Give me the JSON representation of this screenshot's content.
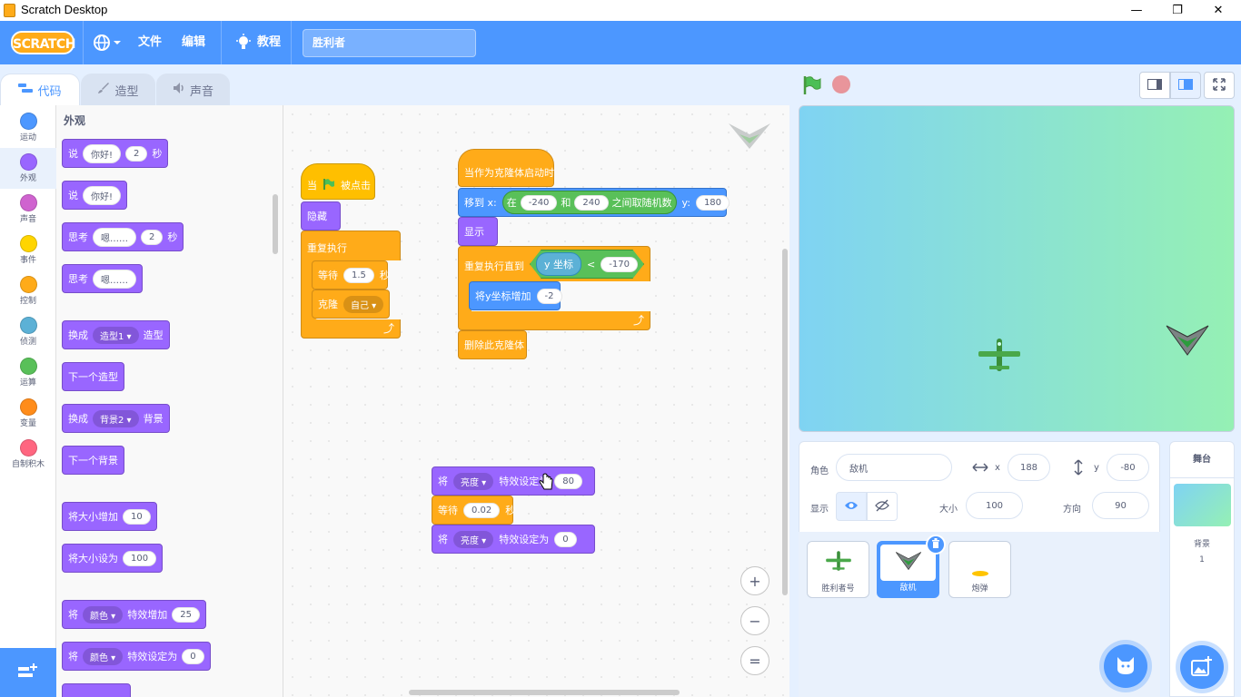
{
  "window": {
    "title": "Scratch Desktop",
    "minimize": "—",
    "restore": "❐",
    "close": "✕"
  },
  "menu": {
    "logo": "SCRATCH",
    "file": "文件",
    "edit": "编辑",
    "tutorials": "教程",
    "project_name": "胜利者"
  },
  "tabs": {
    "code": "代码",
    "costumes": "造型",
    "sounds": "声音"
  },
  "categories": [
    {
      "label": "运动",
      "color": "#4c97ff"
    },
    {
      "label": "外观",
      "color": "#9966ff"
    },
    {
      "label": "声音",
      "color": "#cf63cf"
    },
    {
      "label": "事件",
      "color": "#ffd500"
    },
    {
      "label": "控制",
      "color": "#ffab19"
    },
    {
      "label": "侦测",
      "color": "#5cb1d6"
    },
    {
      "label": "运算",
      "color": "#59c059"
    },
    {
      "label": "变量",
      "color": "#ff8c1a"
    },
    {
      "label": "自制积木",
      "color": "#ff6680"
    }
  ],
  "palette": {
    "title": "外观",
    "say_secs": {
      "a": "说",
      "msg": "你好!",
      "secs": "2",
      "b": "秒"
    },
    "say": {
      "a": "说",
      "msg": "你好!"
    },
    "think_secs": {
      "a": "思考",
      "msg": "嗯……",
      "secs": "2",
      "b": "秒"
    },
    "think": {
      "a": "思考",
      "msg": "嗯……"
    },
    "switch_costume": {
      "a": "换成",
      "dd": "造型1",
      "b": "造型"
    },
    "next_costume": "下一个造型",
    "switch_backdrop": {
      "a": "换成",
      "dd": "背景2",
      "b": "背景"
    },
    "next_backdrop": "下一个背景",
    "change_size": {
      "a": "将大小增加",
      "v": "10"
    },
    "set_size": {
      "a": "将大小设为",
      "v": "100"
    },
    "change_effect": {
      "a": "将",
      "dd": "颜色",
      "b": "特效增加",
      "v": "25"
    },
    "set_effect": {
      "a": "将",
      "dd": "颜色",
      "b": "特效设定为",
      "v": "0"
    }
  },
  "script1": {
    "hat_a": "当",
    "hat_b": "被点击",
    "hide": "隐藏",
    "forever": "重复执行",
    "wait_a": "等待",
    "wait_v": "1.5",
    "wait_b": "秒",
    "clone_a": "克隆",
    "clone_dd": "自己"
  },
  "script2": {
    "hat": "当作为克隆体启动时",
    "goto_a": "移到 x:",
    "rand_a": "在",
    "rand_min": "-240",
    "rand_and": "和",
    "rand_max": "240",
    "rand_b": "之间取随机数",
    "goto_y": "y:",
    "goto_yv": "180",
    "show": "显示",
    "until": "重复执行直到",
    "ycoord": "y 坐标",
    "lt": "<",
    "ltv": "-170",
    "change_y": "将y坐标增加",
    "change_yv": "-2",
    "delete": "删除此克隆体"
  },
  "script3": {
    "set_a": "将",
    "set_dd": "亮度",
    "set_b": "特效设定为",
    "set_v": "80",
    "wait_a": "等待",
    "wait_v": "0.02",
    "wait_b": "秒",
    "set2_a": "将",
    "set2_dd": "亮度",
    "set2_b": "特效设定为",
    "set2_v": "0"
  },
  "zoom": {
    "in": "+",
    "out": "−",
    "reset": "="
  },
  "sprite_info": {
    "sprite_label": "角色",
    "sprite_name": "敌机",
    "x_label": "x",
    "x": "188",
    "y_label": "y",
    "y": "-80",
    "show_label": "显示",
    "size_label": "大小",
    "size": "100",
    "dir_label": "方向",
    "dir": "90"
  },
  "sprites": [
    {
      "name": "胜利者号",
      "selected": false
    },
    {
      "name": "敌机",
      "selected": true
    },
    {
      "name": "炮弹",
      "selected": false
    }
  ],
  "stage_panel": {
    "title": "舞台",
    "backdrop_label": "背景",
    "backdrop_count": "1"
  }
}
